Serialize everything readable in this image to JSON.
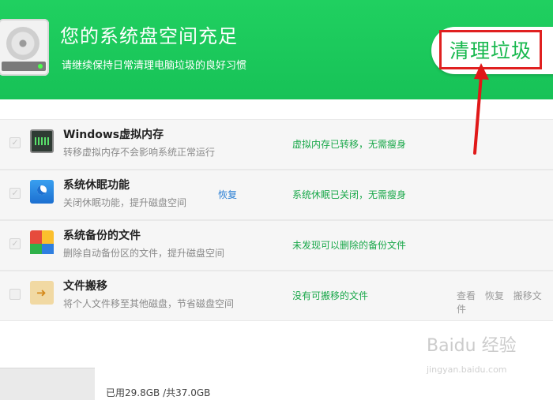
{
  "header": {
    "title": "您的系统盘空间充足",
    "subtitle": "请继续保持日常清理电脑垃圾的良好习惯",
    "clean_button": "清理垃圾",
    "bg_color": "#19c85a"
  },
  "rows": [
    {
      "icon": "memory-chip-icon",
      "title": "Windows虚拟内存",
      "desc": "转移虚拟内存不会影响系统正常运行",
      "status": "虚拟内存已转移，无需瘦身"
    },
    {
      "icon": "sleep-moon-icon",
      "title": "系统休眠功能",
      "desc": "关闭休眠功能，提升磁盘空间",
      "restore": "恢复",
      "status": "系统休眠已关闭，无需瘦身"
    },
    {
      "icon": "backup-files-icon",
      "title": "系统备份的文件",
      "desc": "删除自动备份区的文件，提升磁盘空间",
      "status": "未发现可以删除的备份文件"
    },
    {
      "icon": "move-folder-icon",
      "title": "文件搬移",
      "desc": "将个人文件移至其他磁盘，节省磁盘空间",
      "status": "没有可搬移的文件",
      "actions": [
        "查看",
        "恢复",
        "搬移文件"
      ]
    }
  ],
  "footer": {
    "usage": "已用29.8GB /共37.0GB"
  },
  "watermark": {
    "text": "Baidu 经验",
    "url": "jingyan.baidu.com"
  }
}
